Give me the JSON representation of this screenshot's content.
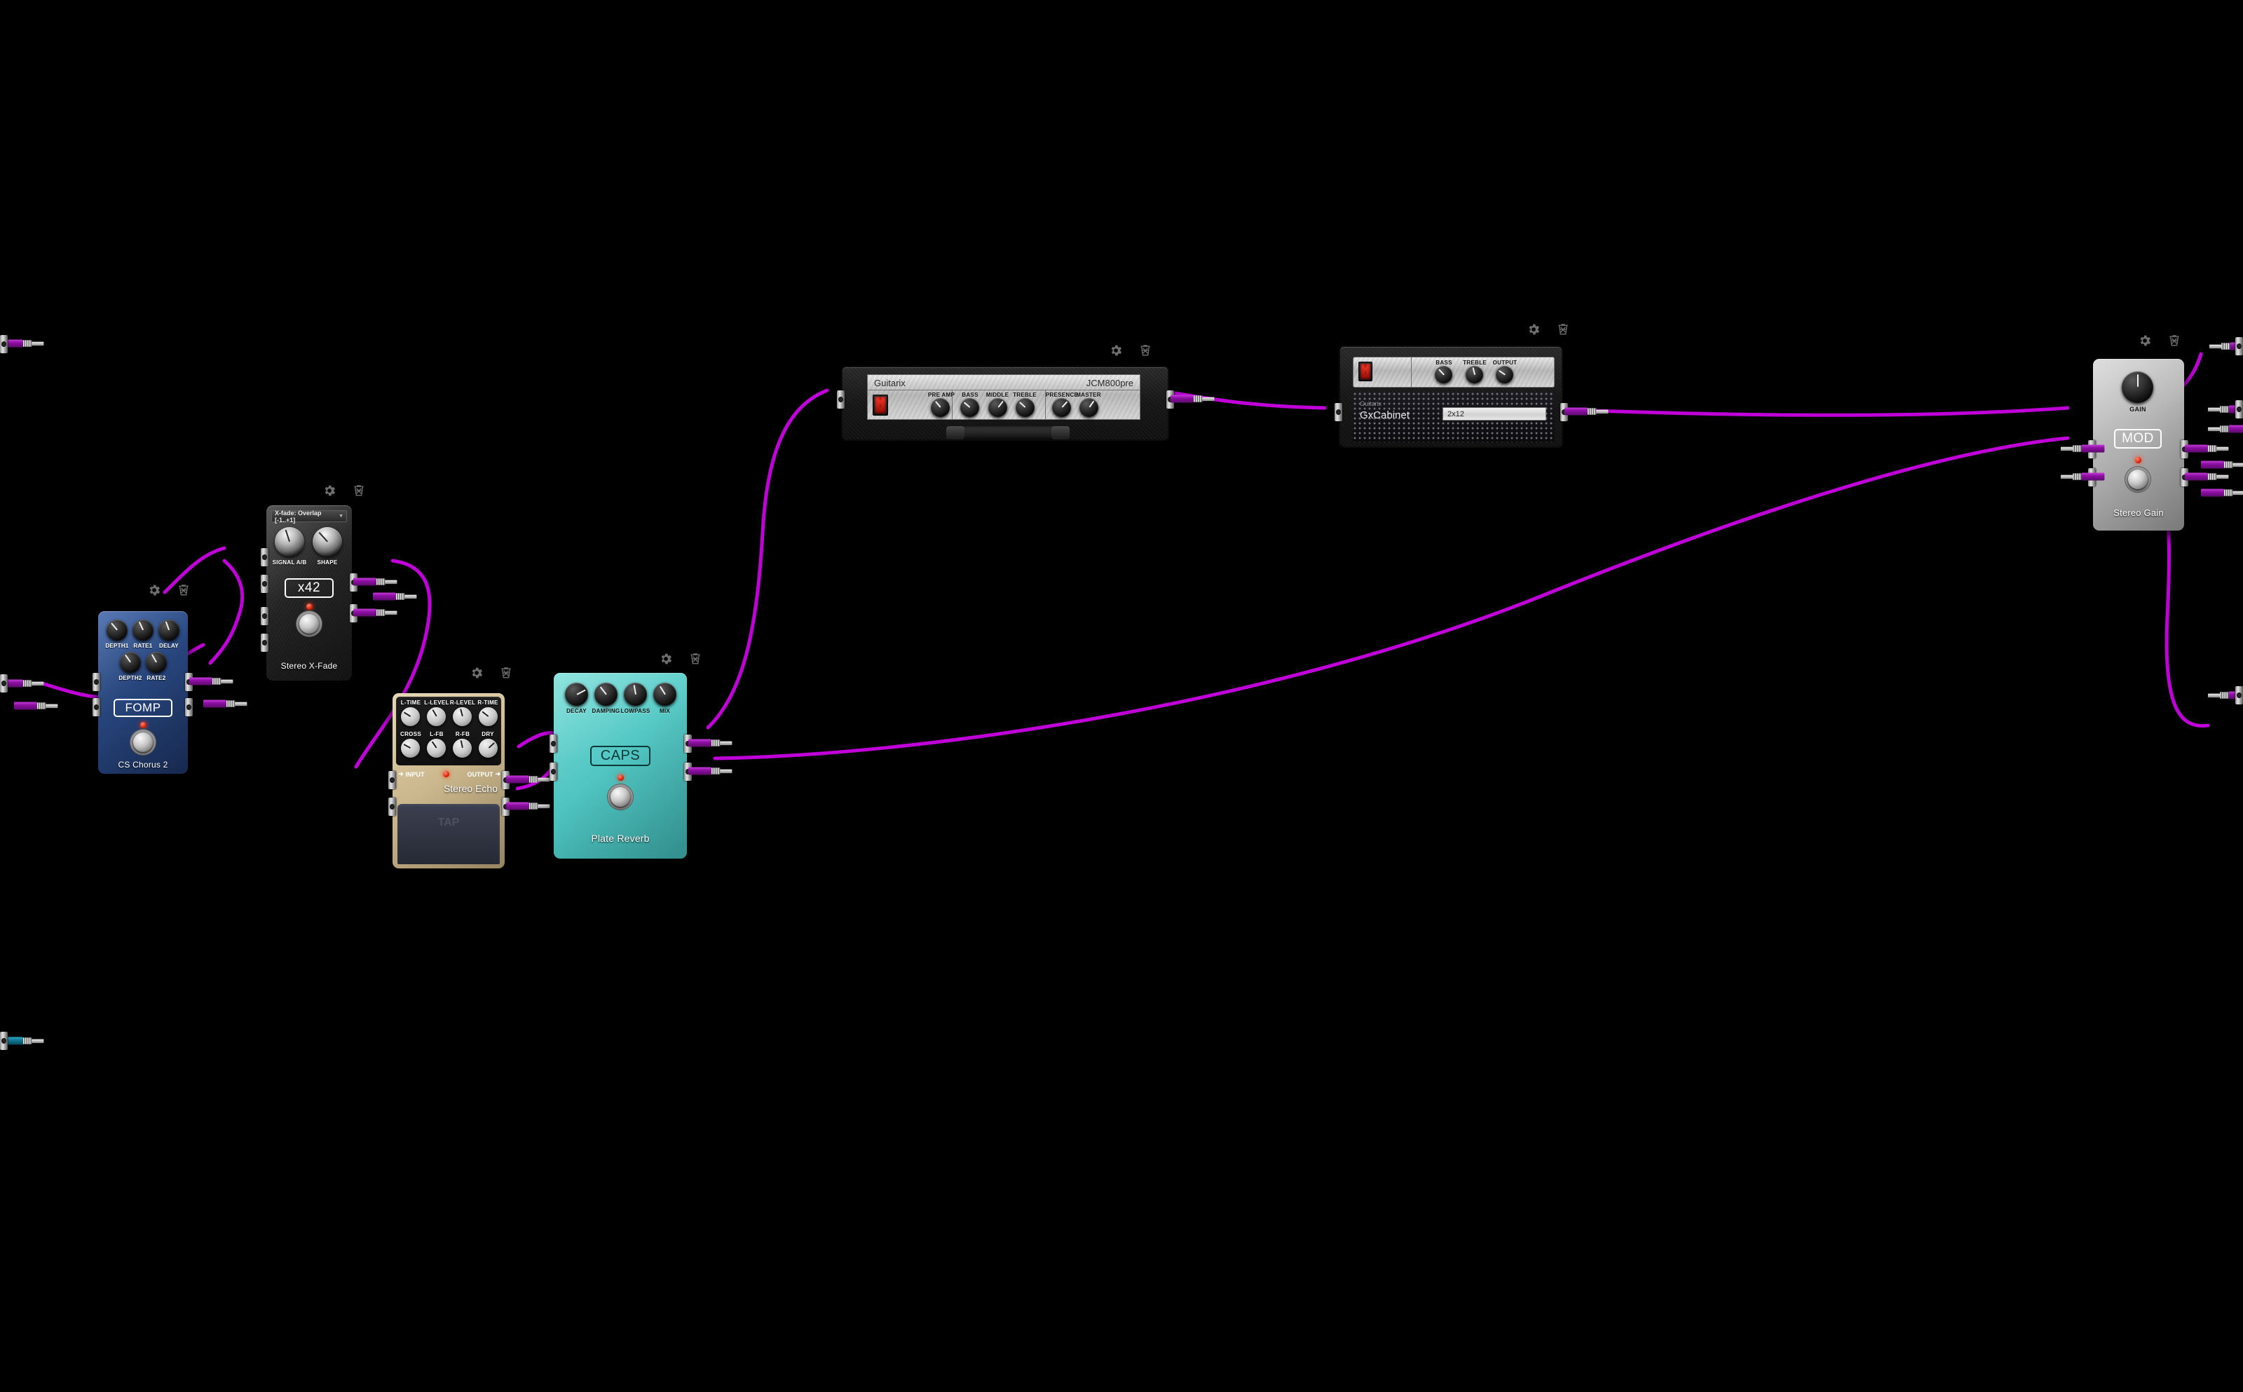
{
  "app": {
    "canvas_background": "#000000",
    "cable_color": "#c000d8"
  },
  "modules": [
    {
      "id": "cs-chorus-2",
      "name": "CS Chorus 2",
      "brand": "FOMP",
      "body_color": "#2f4f8f",
      "tools": {
        "gear": "gear-icon",
        "trash": "trash-icon"
      },
      "knobs": [
        {
          "label": "DEPTH1",
          "angle": -40
        },
        {
          "label": "RATE1",
          "angle": -25
        },
        {
          "label": "DELAY",
          "angle": -20
        },
        {
          "label": "DEPTH2",
          "angle": -35
        },
        {
          "label": "RATE2",
          "angle": -30
        }
      ]
    },
    {
      "id": "stereo-x-fade",
      "name": "Stereo X-Fade",
      "brand": "x42",
      "body_color": "#2a2a2a",
      "select_value": "X-fade: Overlap [-1..+1]",
      "tools": {
        "gear": "gear-icon",
        "trash": "trash-icon"
      },
      "knobs": [
        {
          "label": "SIGNAL A/B",
          "angle": -18
        },
        {
          "label": "SHAPE",
          "angle": -42
        }
      ]
    },
    {
      "id": "stereo-echo",
      "name": "Stereo Echo",
      "body_color": "#d6c4a0",
      "input_label": "INPUT",
      "output_label": "OUTPUT",
      "footswitch_label": "TAP",
      "tools": {
        "gear": "gear-icon",
        "trash": "trash-icon"
      },
      "knobs": [
        {
          "label": "L-TIME",
          "angle": -58
        },
        {
          "label": "L-LEVEL",
          "angle": -30
        },
        {
          "label": "R-LEVEL",
          "angle": -15
        },
        {
          "label": "R-TIME",
          "angle": -52
        },
        {
          "label": "CROSS",
          "angle": -62
        },
        {
          "label": "L-FB",
          "angle": -35
        },
        {
          "label": "R-FB",
          "angle": -12
        },
        {
          "label": "DRY",
          "angle": 48
        }
      ]
    },
    {
      "id": "plate-reverb",
      "name": "Plate Reverb",
      "brand": "CAPS",
      "body_color": "#5fd0cc",
      "tools": {
        "gear": "gear-icon",
        "trash": "trash-icon"
      },
      "knobs": [
        {
          "label": "DECAY",
          "angle": 62
        },
        {
          "label": "DAMPING",
          "angle": -38
        },
        {
          "label": "LOWPASS",
          "angle": -10
        },
        {
          "label": "MIX",
          "angle": -32
        }
      ]
    },
    {
      "id": "jcm800pre",
      "name": "JCM800pre",
      "vendor": "Guitarix",
      "power": "on",
      "tools": {
        "gear": "gear-icon",
        "trash": "trash-icon"
      },
      "knobs": [
        {
          "label": "PRE AMP",
          "angle": -40
        },
        {
          "label": "BASS",
          "angle": -50
        },
        {
          "label": "MIDDLE",
          "angle": 38
        },
        {
          "label": "TREBLE",
          "angle": -48
        },
        {
          "label": "PRESENCE",
          "angle": 42
        },
        {
          "label": "MASTER",
          "angle": 35
        }
      ]
    },
    {
      "id": "gx-cabinet",
      "name": "GxCabinet",
      "vendor": "Guitarix",
      "power": "on",
      "cabinet": "2x12",
      "tools": {
        "gear": "gear-icon",
        "trash": "trash-icon"
      },
      "knobs": [
        {
          "label": "BASS",
          "angle": -44
        },
        {
          "label": "TREBLE",
          "angle": -14
        },
        {
          "label": "OUTPUT",
          "angle": -56
        }
      ]
    },
    {
      "id": "stereo-gain",
      "name": "Stereo Gain",
      "brand": "MOD",
      "body_color": "#b9b9b9",
      "tools": {
        "gear": "gear-icon",
        "trash": "trash-icon"
      },
      "knobs": [
        {
          "label": "GAIN",
          "angle": 0
        }
      ]
    }
  ],
  "connectors": {
    "jack_plug": "jack-plug",
    "midi_plug": "midi-plug"
  }
}
